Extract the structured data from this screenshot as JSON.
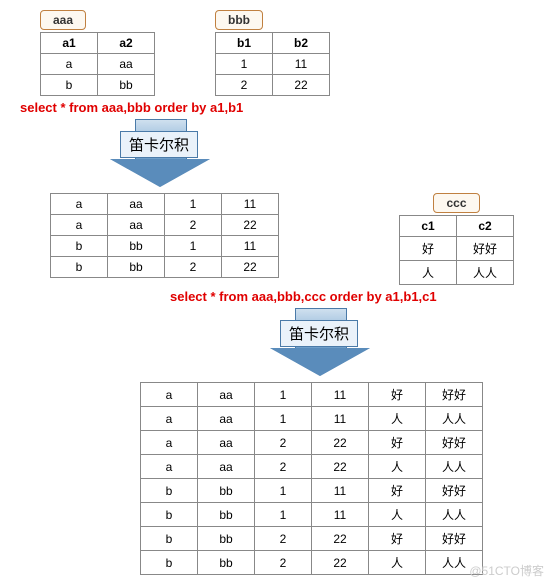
{
  "tables": {
    "aaa": {
      "name": "aaa",
      "headers": [
        "a1",
        "a2"
      ],
      "rows": [
        [
          "a",
          "aa"
        ],
        [
          "b",
          "bb"
        ]
      ]
    },
    "bbb": {
      "name": "bbb",
      "headers": [
        "b1",
        "b2"
      ],
      "rows": [
        [
          "1",
          "11"
        ],
        [
          "2",
          "22"
        ]
      ]
    },
    "ccc": {
      "name": "ccc",
      "headers": [
        "c1",
        "c2"
      ],
      "rows": [
        [
          "好",
          "好好"
        ],
        [
          "人",
          "人人"
        ]
      ]
    }
  },
  "sql1": "select * from aaa,bbb order by a1,b1",
  "sql2": "select * from aaa,bbb,ccc order by a1,b1,c1",
  "arrow_label": "笛卡尔积",
  "result1": {
    "rows": [
      [
        "a",
        "aa",
        "1",
        "11"
      ],
      [
        "a",
        "aa",
        "2",
        "22"
      ],
      [
        "b",
        "bb",
        "1",
        "11"
      ],
      [
        "b",
        "bb",
        "2",
        "22"
      ]
    ]
  },
  "result2": {
    "rows": [
      [
        "a",
        "aa",
        "1",
        "11",
        "好",
        "好好"
      ],
      [
        "a",
        "aa",
        "1",
        "11",
        "人",
        "人人"
      ],
      [
        "a",
        "aa",
        "2",
        "22",
        "好",
        "好好"
      ],
      [
        "a",
        "aa",
        "2",
        "22",
        "人",
        "人人"
      ],
      [
        "b",
        "bb",
        "1",
        "11",
        "好",
        "好好"
      ],
      [
        "b",
        "bb",
        "1",
        "11",
        "人",
        "人人"
      ],
      [
        "b",
        "bb",
        "2",
        "22",
        "好",
        "好好"
      ],
      [
        "b",
        "bb",
        "2",
        "22",
        "人",
        "人人"
      ]
    ]
  },
  "watermark": "@51CTO博客"
}
